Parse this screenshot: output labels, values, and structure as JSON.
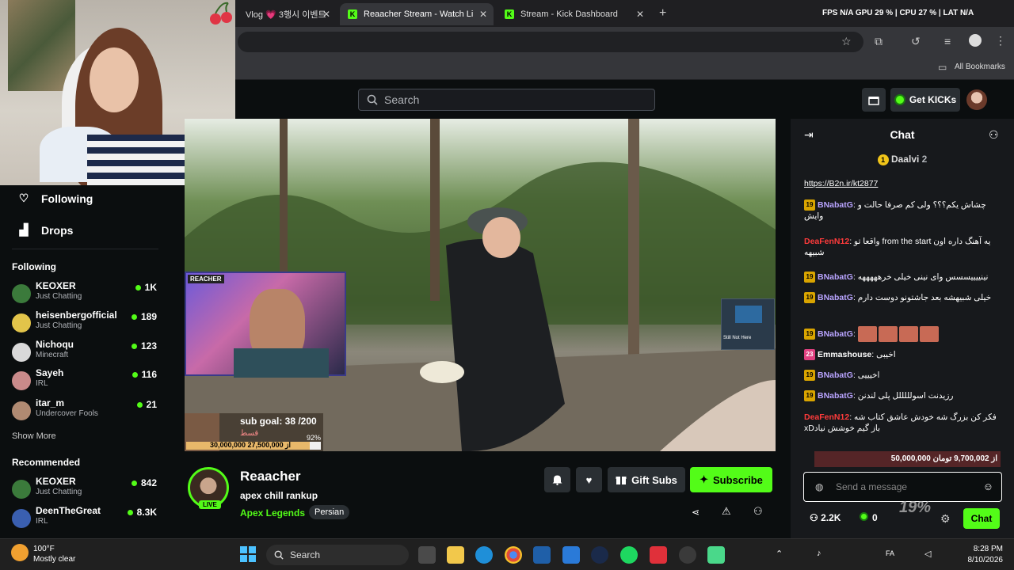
{
  "browser": {
    "tabs": [
      {
        "label": "Vlog 💗 3행시 이벤트"
      },
      {
        "label": "Reaacher Stream - Watch Li"
      },
      {
        "label": "Stream - Kick Dashboard"
      }
    ],
    "bookmarks_label": "All Bookmarks",
    "perf_overlay": "FPS  N/A  GPU 29 %  |  CPU 27 %  |  LAT  N/A"
  },
  "header": {
    "search_placeholder": "Search",
    "get_kicks_label": "Get KICKs"
  },
  "sidebar": {
    "nav": [
      {
        "label": "Following"
      },
      {
        "label": "Drops"
      }
    ],
    "following_title": "Following",
    "following": [
      {
        "name": "KEOXER",
        "category": "Just Chatting",
        "viewers": "1K"
      },
      {
        "name": "heisenbergofficial",
        "category": "Just Chatting",
        "viewers": "189"
      },
      {
        "name": "Nichoqu",
        "category": "Minecraft",
        "viewers": "123"
      },
      {
        "name": "Sayeh",
        "category": "IRL",
        "viewers": "116"
      },
      {
        "name": "itar_m",
        "category": "Undercover Fools",
        "viewers": "21"
      }
    ],
    "show_more": "Show More",
    "recommended_title": "Recommended",
    "recommended": [
      {
        "name": "KEOXER",
        "category": "Just Chatting",
        "viewers": "842"
      },
      {
        "name": "DeenTheGreat",
        "category": "IRL",
        "viewers": "8.3K"
      }
    ]
  },
  "video": {
    "sub_goal": "sub goal: 38 /200",
    "donation_text": "30,000,000 از 27,500,000",
    "donation_percent": "92%",
    "donation_label": "قسط",
    "facecam_label": "REACHER",
    "notify_text": "Still Not Here"
  },
  "channel": {
    "name": "Reaacher",
    "live_label": "LIVE",
    "title": "apex chill rankup",
    "category": "Apex Legends",
    "tag": "Persian",
    "gift_subs_label": "Gift Subs",
    "subscribe_label": "Subscribe"
  },
  "chat": {
    "title": "Chat",
    "pinned_user": "Daalvi",
    "pinned_count": "2",
    "messages": [
      {
        "text": "https://B2n.ir/kt2877"
      },
      {
        "badge": "19",
        "user": "BNabatG",
        "text": "چشاش یکم؟؟؟ ولی کم صرفا حالت و وایش",
        "color": "#b9a4ff"
      },
      {
        "user": "DeaFenN12",
        "text": "واقعا تو from the start یه آهنگ داره اون شبیهه",
        "color": "#ff3b3b"
      },
      {
        "badge": "19",
        "user": "BNabatG",
        "text": "نینییییسسس وای نینی خیلی خرهههههه",
        "color": "#b9a4ff"
      },
      {
        "badge": "19",
        "user": "BNabatG",
        "text": "خیلی شبیهشه بعد جاشتونو دوست دارم",
        "color": "#b9a4ff"
      },
      {
        "badge": "19",
        "user": "BNabatG",
        "text": "",
        "color": "#b9a4ff"
      },
      {
        "badge": "23",
        "user": "Emmashouse",
        "text": "اخیبی",
        "color": "#ffffff"
      },
      {
        "badge": "19",
        "user": "BNabatG",
        "text": "اخیییی",
        "color": "#b9a4ff"
      },
      {
        "badge": "19",
        "user": "BNabatG",
        "text": "رزیدنت اسولللللل پلی لندنن",
        "color": "#b9a4ff"
      },
      {
        "user": "DeaFenN12",
        "text": "فکر کن بزرگ شه خودش عاشق کتاب شه xDباز گیم خوشش نیاد",
        "color": "#ff3b3b"
      }
    ],
    "bottom_goal_text": "50,000,000 از 9,700,002 تومان",
    "input_placeholder": "Send a message",
    "viewers_label": "2.2K",
    "kicks_count": "0",
    "chat_button_label": "Chat",
    "overlay_percent": "19%"
  },
  "taskbar": {
    "weather_temp": "100°F",
    "weather_desc": "Mostly clear",
    "search_label": "Search",
    "lang": "FA",
    "time": "8:28 PM",
    "date": "8/10/2026"
  }
}
